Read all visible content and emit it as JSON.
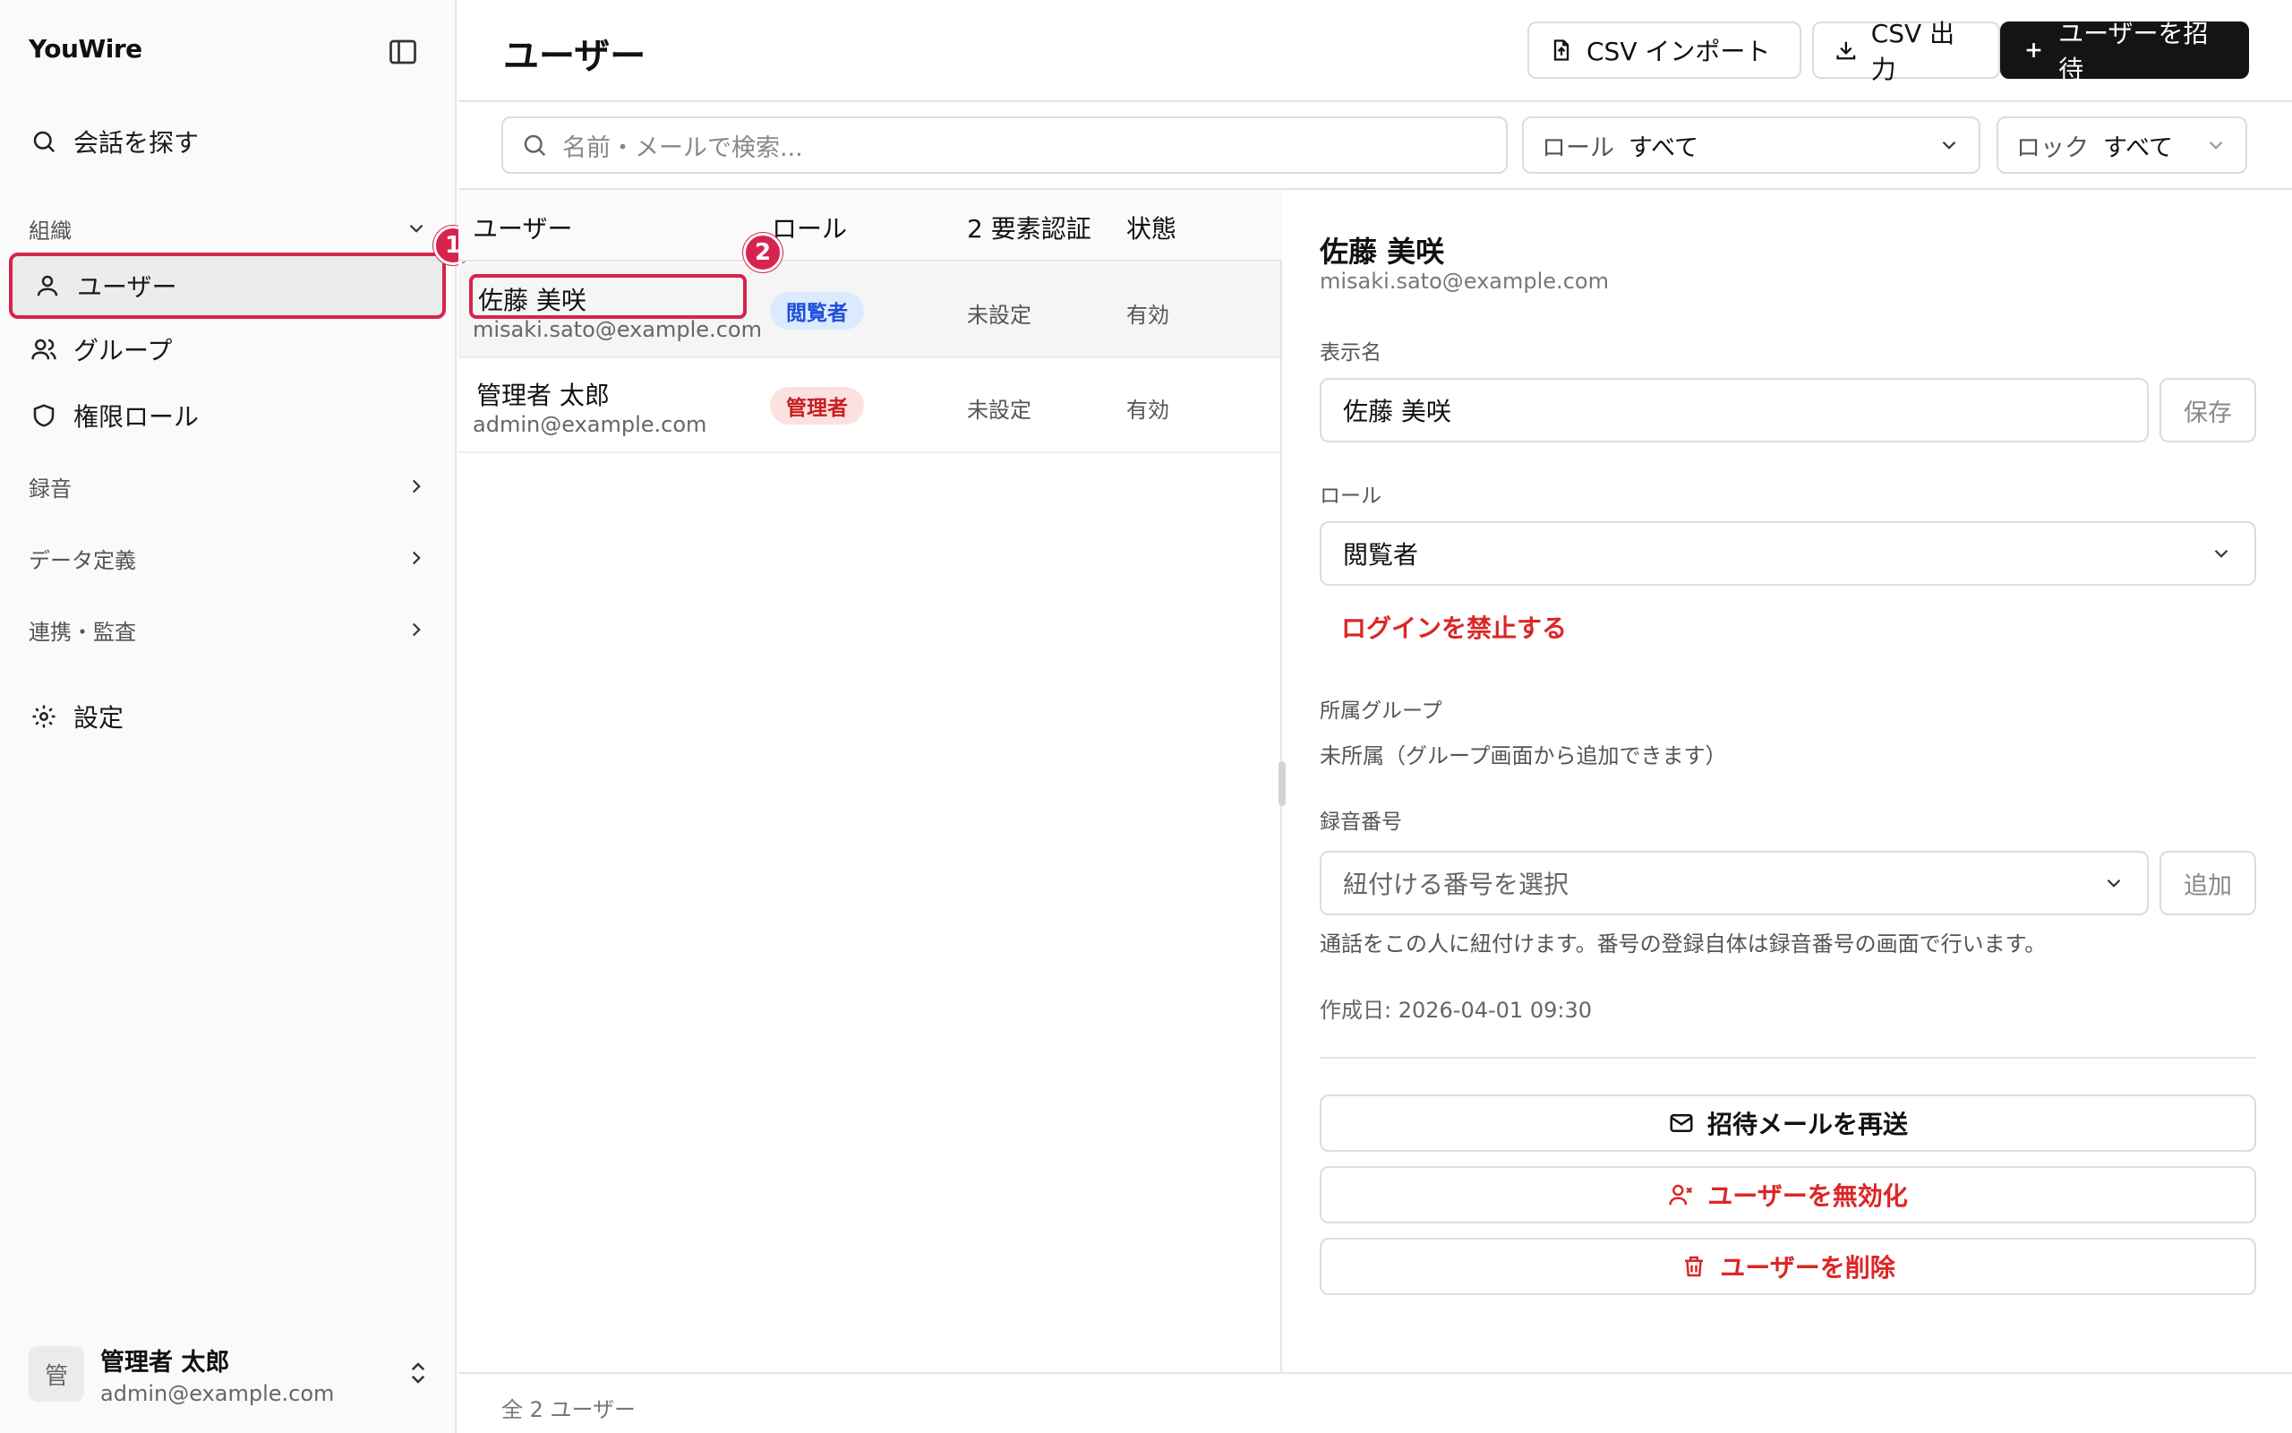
{
  "app": {
    "brand": "YouWire"
  },
  "sidebar": {
    "search_label": "会話を探す",
    "section_org": "組織",
    "items": [
      {
        "label": "ユーザー",
        "active": true
      },
      {
        "label": "グループ"
      },
      {
        "label": "権限ロール"
      }
    ],
    "sections": [
      {
        "label": "録音"
      },
      {
        "label": "データ定義"
      },
      {
        "label": "連携・監査"
      }
    ],
    "settings_label": "設定",
    "annotations": [
      "1",
      "2"
    ],
    "user": {
      "avatar_char": "管",
      "name": "管理者 太郎",
      "email": "admin@example.com"
    }
  },
  "header": {
    "title": "ユーザー",
    "import_label": "CSV インポート",
    "export_label": "CSV 出力",
    "invite_label": "ユーザーを招待"
  },
  "filters": {
    "search_placeholder": "名前・メールで検索...",
    "role_label": "ロール",
    "role_value": "すべて",
    "lock_label": "ロック",
    "lock_value": "すべて"
  },
  "table": {
    "columns": [
      "ユーザー",
      "ロール",
      "2 要素認証",
      "状態"
    ],
    "rows": [
      {
        "name": "佐藤 美咲",
        "email": "misaki.sato@example.com",
        "role": "閲覧者",
        "mfa": "未設定",
        "status": "有効",
        "selected": true
      },
      {
        "name": "管理者 太郎",
        "email": "admin@example.com",
        "role": "管理者",
        "mfa": "未設定",
        "status": "有効"
      }
    ],
    "footer": "全 2 ユーザー"
  },
  "detail": {
    "name": "佐藤 美咲",
    "email": "misaki.sato@example.com",
    "display_name_label": "表示名",
    "display_name_value": "佐藤 美咲",
    "save_label": "保存",
    "role_label": "ロール",
    "role_value": "閲覧者",
    "ban_login_label": "ログインを禁止する",
    "groups_label": "所属グループ",
    "groups_value": "未所属（グループ画面から追加できます）",
    "numbers_label": "録音番号",
    "numbers_placeholder": "紐付ける番号を選択",
    "add_label": "追加",
    "numbers_help": "通話をこの人に紐付けます。番号の登録自体は録音番号の画面で行います。",
    "created_at": "作成日: 2026-04-01 09:30",
    "resend_label": "招待メールを再送",
    "disable_label": "ユーザーを無効化",
    "delete_label": "ユーザーを削除"
  },
  "colors": {
    "accent_annotation": "#d6244e",
    "danger": "#dc2626",
    "primary_button": "#141414"
  }
}
